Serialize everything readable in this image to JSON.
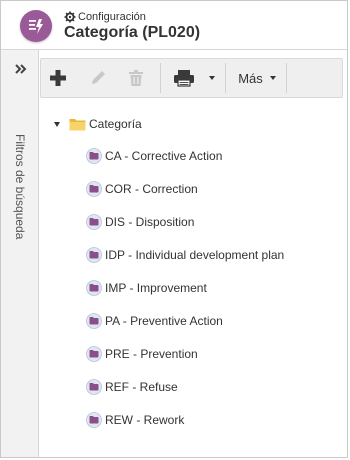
{
  "header": {
    "breadcrumb": "Configuración",
    "title": "Categoría (PL020)",
    "app_icon_color": "#9a5a98"
  },
  "side_panel": {
    "label": "Filtros de búsqueda",
    "expand_icon": "double-chevron-right-icon"
  },
  "toolbar": {
    "add_icon": "plus-icon",
    "edit_icon": "pencil-icon",
    "delete_icon": "trash-icon",
    "print_icon": "printer-icon",
    "more_label": "Más"
  },
  "tree": {
    "root_label": "Categoría",
    "items": [
      "CA - Corrective Action",
      "COR - Correction",
      "DIS - Disposition",
      "IDP - Individual development plan",
      "IMP - Improvement",
      "PA - Preventive Action",
      "PRE - Prevention",
      "REF - Refuse",
      "REW - Rework"
    ]
  },
  "colors": {
    "accent": "#9a5a98",
    "folder": "#f2c94c",
    "item_icon": "#8a4f88"
  }
}
